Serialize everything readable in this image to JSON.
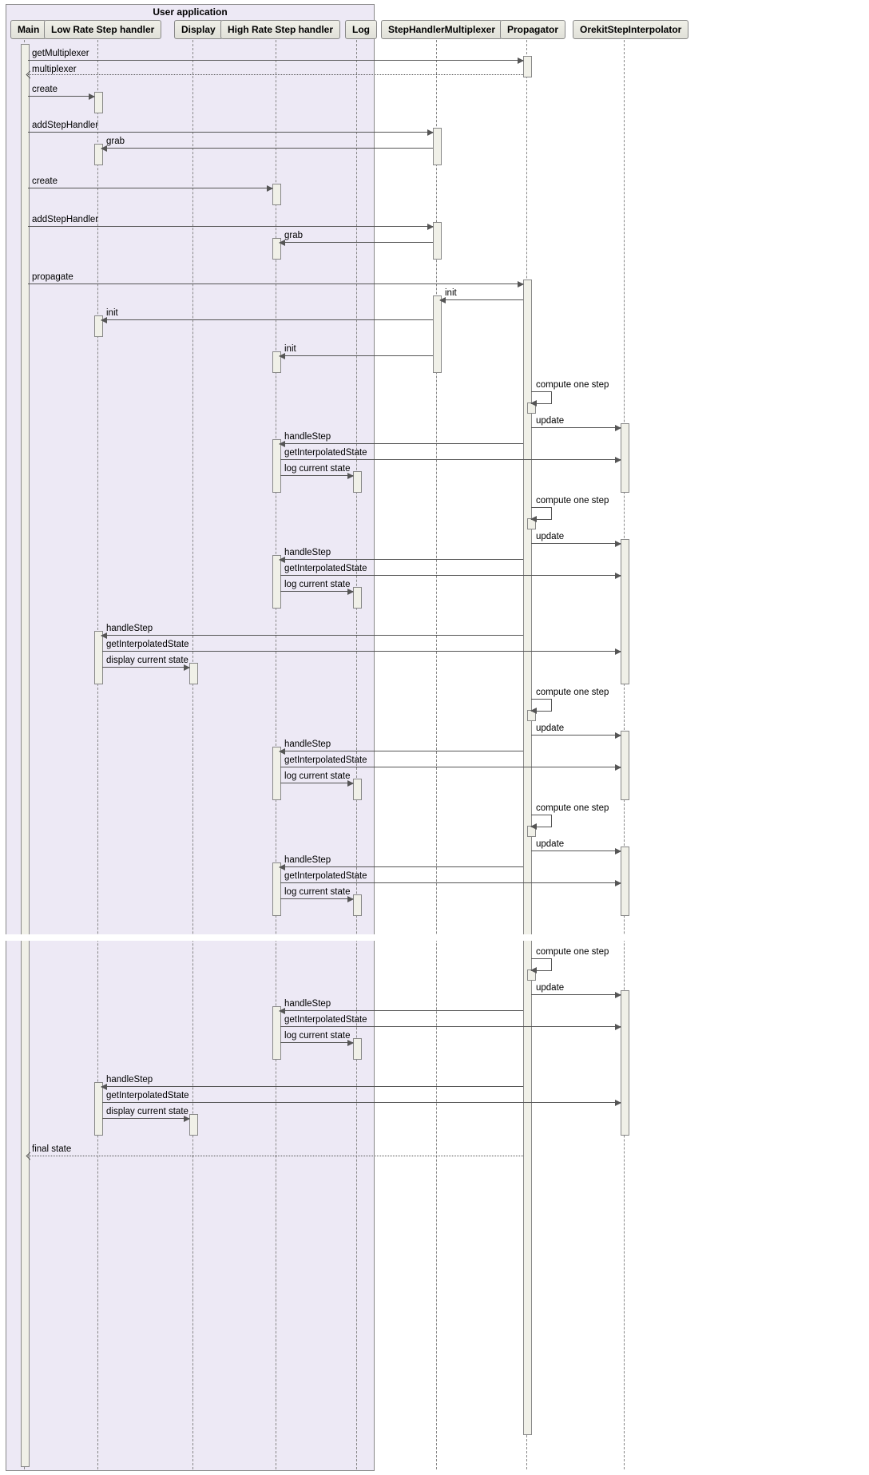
{
  "frame": {
    "title": "User application"
  },
  "participants": {
    "main": "Main",
    "low_rate": "Low Rate Step handler",
    "display": "Display",
    "high_rate": "High Rate Step handler",
    "log": "Log",
    "multiplexer": "StepHandlerMultiplexer",
    "propagator": "Propagator",
    "interpolator": "OrekitStepInterpolator"
  },
  "messages": {
    "getMultiplexer": "getMultiplexer",
    "multiplexer_return": "multiplexer",
    "create": "create",
    "addStepHandler": "addStepHandler",
    "grab": "grab",
    "propagate": "propagate",
    "init": "init",
    "compute_one_step": "compute one step",
    "update": "update",
    "handleStep": "handleStep",
    "getInterpolatedState": "getInterpolatedState",
    "log_current_state": "log current state",
    "display_current_state": "display current state",
    "final_state": "final state"
  },
  "chart_data": {
    "type": "sequence_diagram",
    "participants": [
      {
        "id": "main",
        "name": "Main",
        "group": "User application"
      },
      {
        "id": "low_rate",
        "name": "Low Rate Step handler",
        "group": "User application"
      },
      {
        "id": "display",
        "name": "Display",
        "group": "User application"
      },
      {
        "id": "high_rate",
        "name": "High Rate Step handler",
        "group": "User application"
      },
      {
        "id": "log",
        "name": "Log",
        "group": "User application"
      },
      {
        "id": "multiplexer",
        "name": "StepHandlerMultiplexer"
      },
      {
        "id": "propagator",
        "name": "Propagator"
      },
      {
        "id": "interpolator",
        "name": "OrekitStepInterpolator"
      }
    ],
    "interactions": [
      {
        "from": "main",
        "to": "propagator",
        "label": "getMultiplexer",
        "type": "sync"
      },
      {
        "from": "propagator",
        "to": "main",
        "label": "multiplexer",
        "type": "return"
      },
      {
        "from": "main",
        "to": "low_rate",
        "label": "create",
        "type": "sync"
      },
      {
        "from": "main",
        "to": "multiplexer",
        "label": "addStepHandler",
        "type": "sync"
      },
      {
        "from": "multiplexer",
        "to": "low_rate",
        "label": "grab",
        "type": "sync"
      },
      {
        "from": "main",
        "to": "high_rate",
        "label": "create",
        "type": "sync"
      },
      {
        "from": "main",
        "to": "multiplexer",
        "label": "addStepHandler",
        "type": "sync"
      },
      {
        "from": "multiplexer",
        "to": "high_rate",
        "label": "grab",
        "type": "sync"
      },
      {
        "from": "main",
        "to": "propagator",
        "label": "propagate",
        "type": "sync"
      },
      {
        "from": "propagator",
        "to": "multiplexer",
        "label": "init",
        "type": "sync"
      },
      {
        "from": "multiplexer",
        "to": "low_rate",
        "label": "init",
        "type": "sync"
      },
      {
        "from": "multiplexer",
        "to": "high_rate",
        "label": "init",
        "type": "sync"
      },
      {
        "from": "propagator",
        "to": "propagator",
        "label": "compute one step",
        "type": "self"
      },
      {
        "from": "propagator",
        "to": "interpolator",
        "label": "update",
        "type": "sync"
      },
      {
        "from": "propagator",
        "to": "high_rate",
        "label": "handleStep",
        "type": "sync"
      },
      {
        "from": "high_rate",
        "to": "interpolator",
        "label": "getInterpolatedState",
        "type": "sync"
      },
      {
        "from": "high_rate",
        "to": "log",
        "label": "log current state",
        "type": "sync"
      },
      {
        "from": "propagator",
        "to": "propagator",
        "label": "compute one step",
        "type": "self"
      },
      {
        "from": "propagator",
        "to": "interpolator",
        "label": "update",
        "type": "sync"
      },
      {
        "from": "propagator",
        "to": "high_rate",
        "label": "handleStep",
        "type": "sync"
      },
      {
        "from": "high_rate",
        "to": "interpolator",
        "label": "getInterpolatedState",
        "type": "sync"
      },
      {
        "from": "high_rate",
        "to": "log",
        "label": "log current state",
        "type": "sync"
      },
      {
        "from": "propagator",
        "to": "low_rate",
        "label": "handleStep",
        "type": "sync"
      },
      {
        "from": "low_rate",
        "to": "interpolator",
        "label": "getInterpolatedState",
        "type": "sync"
      },
      {
        "from": "low_rate",
        "to": "display",
        "label": "display current state",
        "type": "sync"
      },
      {
        "from": "propagator",
        "to": "propagator",
        "label": "compute one step",
        "type": "self"
      },
      {
        "from": "propagator",
        "to": "interpolator",
        "label": "update",
        "type": "sync"
      },
      {
        "from": "propagator",
        "to": "high_rate",
        "label": "handleStep",
        "type": "sync"
      },
      {
        "from": "high_rate",
        "to": "interpolator",
        "label": "getInterpolatedState",
        "type": "sync"
      },
      {
        "from": "high_rate",
        "to": "log",
        "label": "log current state",
        "type": "sync"
      },
      {
        "from": "propagator",
        "to": "propagator",
        "label": "compute one step",
        "type": "self"
      },
      {
        "from": "propagator",
        "to": "interpolator",
        "label": "update",
        "type": "sync"
      },
      {
        "from": "propagator",
        "to": "high_rate",
        "label": "handleStep",
        "type": "sync"
      },
      {
        "from": "high_rate",
        "to": "interpolator",
        "label": "getInterpolatedState",
        "type": "sync"
      },
      {
        "from": "high_rate",
        "to": "log",
        "label": "log current state",
        "type": "sync"
      },
      {
        "note": "time break"
      },
      {
        "from": "propagator",
        "to": "propagator",
        "label": "compute one step",
        "type": "self"
      },
      {
        "from": "propagator",
        "to": "interpolator",
        "label": "update",
        "type": "sync"
      },
      {
        "from": "propagator",
        "to": "high_rate",
        "label": "handleStep",
        "type": "sync"
      },
      {
        "from": "high_rate",
        "to": "interpolator",
        "label": "getInterpolatedState",
        "type": "sync"
      },
      {
        "from": "high_rate",
        "to": "log",
        "label": "log current state",
        "type": "sync"
      },
      {
        "from": "propagator",
        "to": "low_rate",
        "label": "handleStep",
        "type": "sync"
      },
      {
        "from": "low_rate",
        "to": "interpolator",
        "label": "getInterpolatedState",
        "type": "sync"
      },
      {
        "from": "low_rate",
        "to": "display",
        "label": "display current state",
        "type": "sync"
      },
      {
        "from": "propagator",
        "to": "main",
        "label": "final state",
        "type": "return"
      }
    ]
  }
}
